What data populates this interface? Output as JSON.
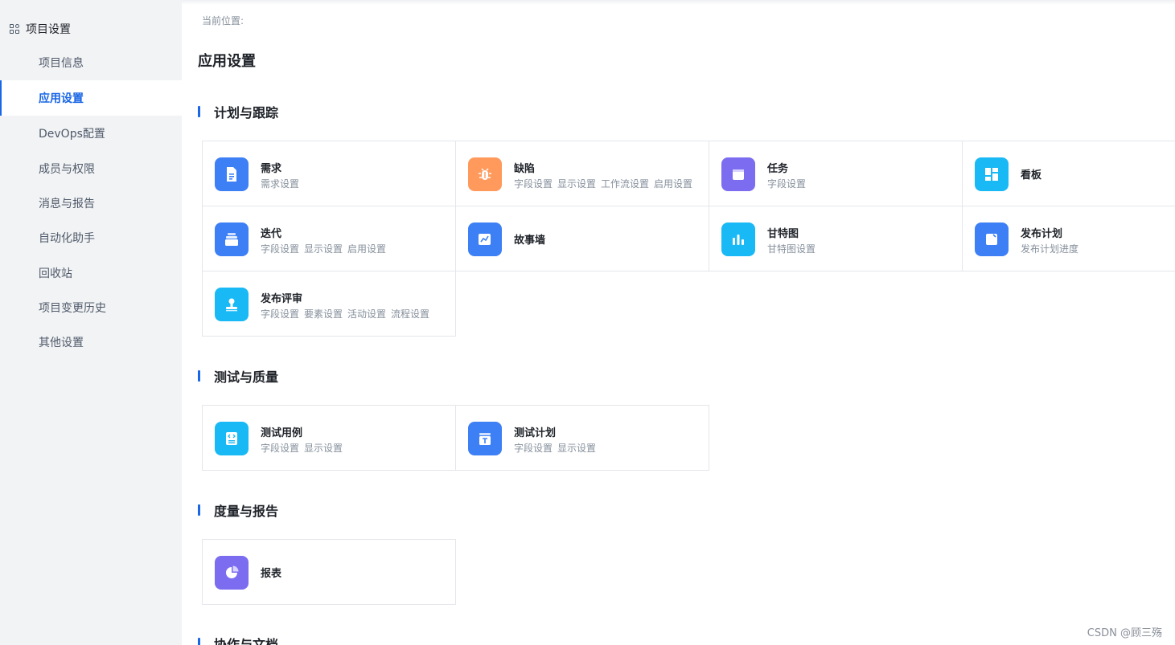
{
  "sidebar": {
    "header": {
      "label": "项目设置",
      "icon": "grid-icon"
    },
    "items": [
      {
        "label": "项目信息",
        "active": false
      },
      {
        "label": "应用设置",
        "active": true
      },
      {
        "label": "DevOps配置",
        "active": false
      },
      {
        "label": "成员与权限",
        "active": false
      },
      {
        "label": "消息与报告",
        "active": false
      },
      {
        "label": "自动化助手",
        "active": false
      },
      {
        "label": "回收站",
        "active": false
      },
      {
        "label": "项目变更历史",
        "active": false
      },
      {
        "label": "其他设置",
        "active": false
      }
    ]
  },
  "breadcrumb": "当前位置:",
  "page_title": "应用设置",
  "sections": [
    {
      "title": "计划与跟踪",
      "cards": [
        {
          "name": "需求",
          "icon": "document-icon",
          "color": "#3d7ff5",
          "subs": [
            "需求设置"
          ]
        },
        {
          "name": "缺陷",
          "icon": "bug-icon",
          "color": "#ff9a5c",
          "subs": [
            "字段设置",
            "显示设置",
            "工作流设置",
            "启用设置"
          ]
        },
        {
          "name": "任务",
          "icon": "calendar-icon",
          "color": "#7b6cf0",
          "subs": [
            "字段设置"
          ]
        },
        {
          "name": "看板",
          "icon": "board-icon",
          "color": "#19b9f5",
          "subs": []
        },
        {
          "name": "迭代",
          "icon": "stack-icon",
          "color": "#3d7ff5",
          "subs": [
            "字段设置",
            "显示设置",
            "启用设置"
          ]
        },
        {
          "name": "故事墙",
          "icon": "trend-chart-icon",
          "color": "#3d7ff5",
          "subs": []
        },
        {
          "name": "甘特图",
          "icon": "bar-chart-icon",
          "color": "#19b9f5",
          "subs": [
            "甘特图设置"
          ]
        },
        {
          "name": "发布计划",
          "icon": "edit-note-icon",
          "color": "#3d7ff5",
          "subs": [
            "发布计划进度"
          ]
        },
        {
          "name": "发布评审",
          "icon": "stamp-icon",
          "color": "#19b9f5",
          "subs": [
            "字段设置",
            "要素设置",
            "活动设置",
            "流程设置"
          ]
        }
      ]
    },
    {
      "title": "测试与质量",
      "cards": [
        {
          "name": "测试用例",
          "icon": "code-doc-icon",
          "color": "#19b9f5",
          "subs": [
            "字段设置",
            "显示设置"
          ]
        },
        {
          "name": "测试计划",
          "icon": "test-plan-icon",
          "color": "#3d7ff5",
          "subs": [
            "字段设置",
            "显示设置"
          ]
        }
      ]
    },
    {
      "title": "度量与报告",
      "cards": [
        {
          "name": "报表",
          "icon": "pie-chart-icon",
          "color": "#7b6cf0",
          "subs": []
        }
      ]
    },
    {
      "title": "协作与文档",
      "cards": []
    }
  ],
  "watermark": "CSDN @顾三殇"
}
